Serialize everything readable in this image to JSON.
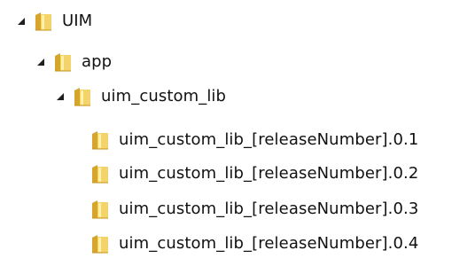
{
  "tree": {
    "root": {
      "label": "UIM",
      "expanded": true,
      "icon": "folder-icon",
      "children": {
        "app": {
          "label": "app",
          "expanded": true,
          "icon": "folder-icon",
          "children": {
            "uim_custom_lib": {
              "label": "uim_custom_lib",
              "expanded": true,
              "icon": "folder-icon",
              "children": [
                {
                  "label": "uim_custom_lib_[releaseNumber].0.1",
                  "icon": "folder-icon"
                },
                {
                  "label": "uim_custom_lib_[releaseNumber].0.2",
                  "icon": "folder-icon"
                },
                {
                  "label": "uim_custom_lib_[releaseNumber].0.3",
                  "icon": "folder-icon"
                },
                {
                  "label": "uim_custom_lib_[releaseNumber].0.4",
                  "icon": "folder-icon"
                }
              ]
            }
          }
        }
      }
    }
  },
  "colors": {
    "folder_dark": "#d6a52b",
    "folder_light": "#f4d46a",
    "folder_highlight": "#fff2b0",
    "toggle": "#1f1f1f",
    "text": "#111111"
  }
}
